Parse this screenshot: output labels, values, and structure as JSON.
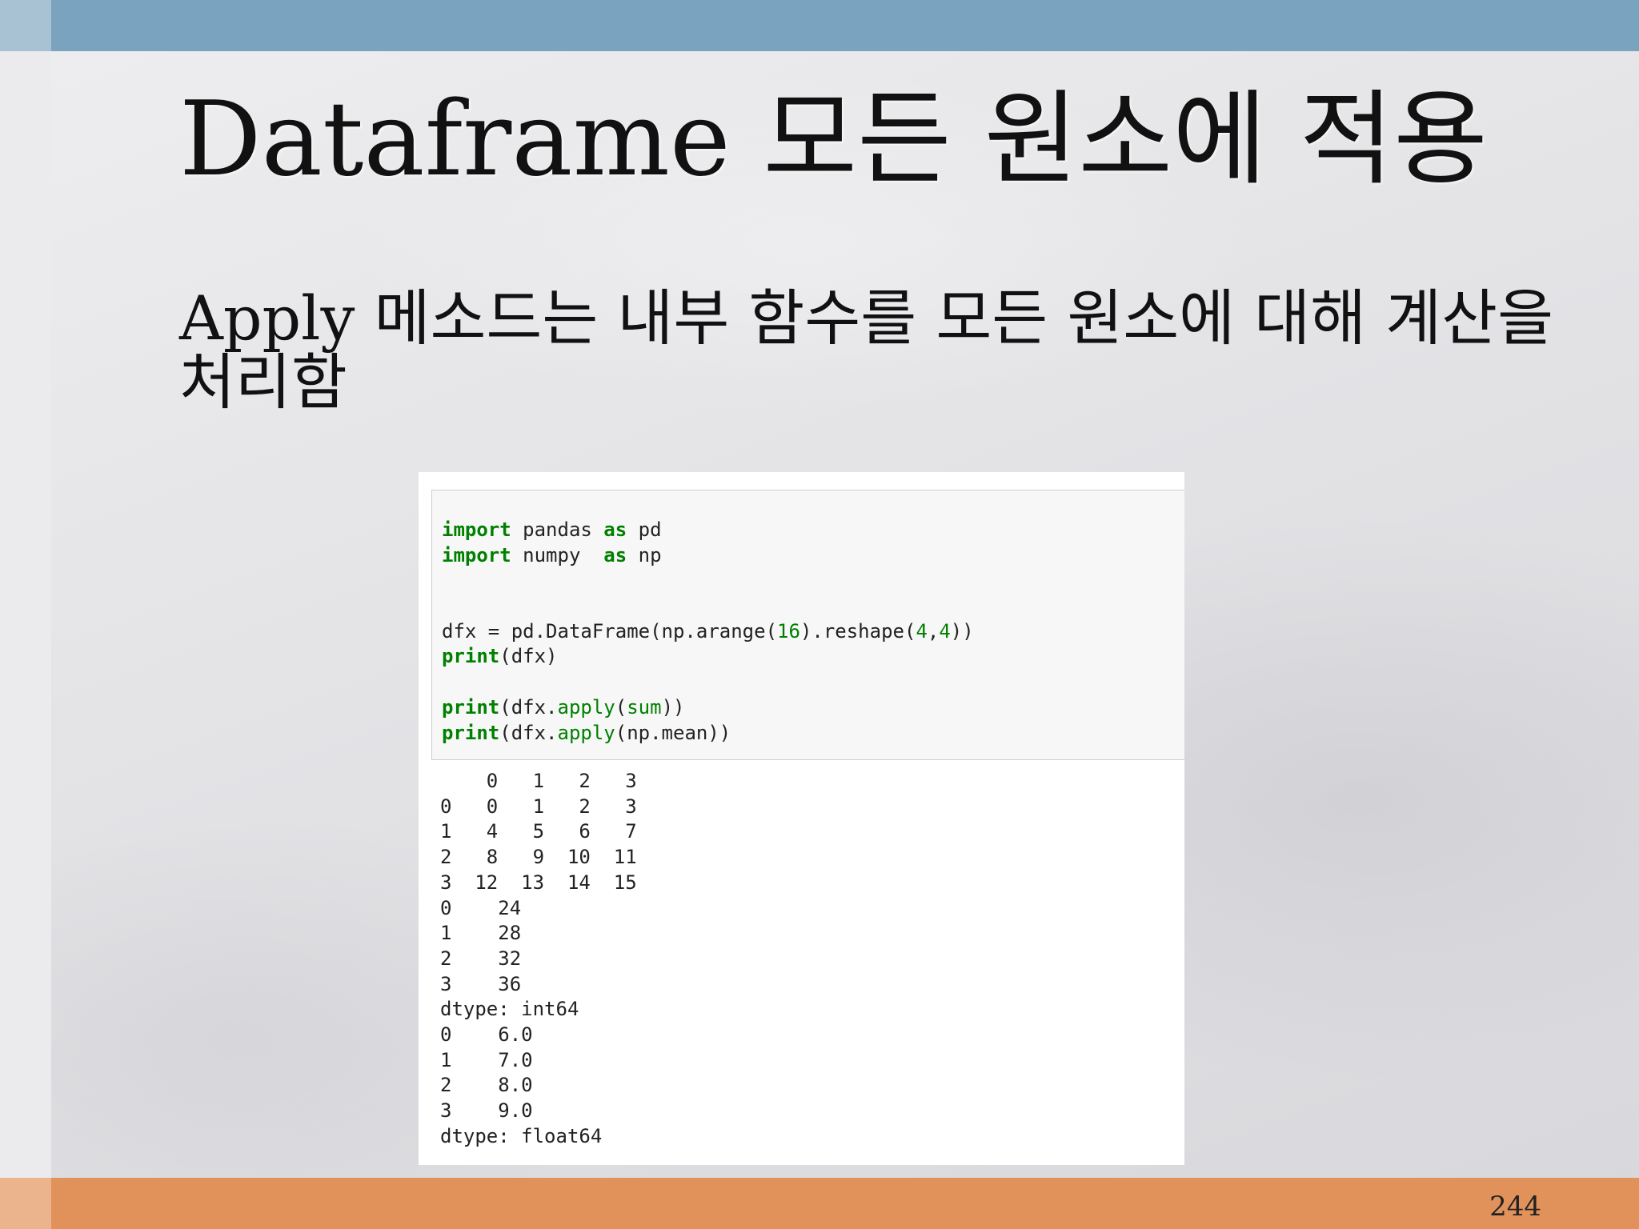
{
  "slide": {
    "title": "Dataframe 모든 원소에 적용",
    "body": "Apply 메소드는 내부 함수를 모든 원소에 대해 계산을 처리함",
    "page_number": "244"
  },
  "code": {
    "lines": [
      [
        {
          "t": "import",
          "c": "kw"
        },
        {
          "t": " pandas "
        },
        {
          "t": "as",
          "c": "kw"
        },
        {
          "t": " pd"
        }
      ],
      [
        {
          "t": "import",
          "c": "kw"
        },
        {
          "t": " numpy  "
        },
        {
          "t": "as",
          "c": "kw"
        },
        {
          "t": " np"
        }
      ],
      [],
      [],
      [
        {
          "t": "dfx = pd.DataFrame(np.arange("
        },
        {
          "t": "16",
          "c": "num"
        },
        {
          "t": ").reshape("
        },
        {
          "t": "4",
          "c": "num"
        },
        {
          "t": ","
        },
        {
          "t": "4",
          "c": "num"
        },
        {
          "t": "))"
        }
      ],
      [
        {
          "t": "print",
          "c": "kw"
        },
        {
          "t": "(dfx)"
        }
      ],
      [],
      [
        {
          "t": "print",
          "c": "kw"
        },
        {
          "t": "(dfx."
        },
        {
          "t": "apply",
          "c": "fn"
        },
        {
          "t": "("
        },
        {
          "t": "sum",
          "c": "fn"
        },
        {
          "t": "))"
        }
      ],
      [
        {
          "t": "print",
          "c": "kw"
        },
        {
          "t": "(dfx."
        },
        {
          "t": "apply",
          "c": "fn"
        },
        {
          "t": "(np.mean))"
        }
      ]
    ]
  },
  "output": {
    "lines": [
      "    0   1   2   3",
      "0   0   1   2   3",
      "1   4   5   6   7",
      "2   8   9  10  11",
      "3  12  13  14  15",
      "0    24",
      "1    28",
      "2    32",
      "3    36",
      "dtype: int64",
      "0    6.0",
      "1    7.0",
      "2    8.0",
      "3    9.0",
      "dtype: float64"
    ]
  }
}
